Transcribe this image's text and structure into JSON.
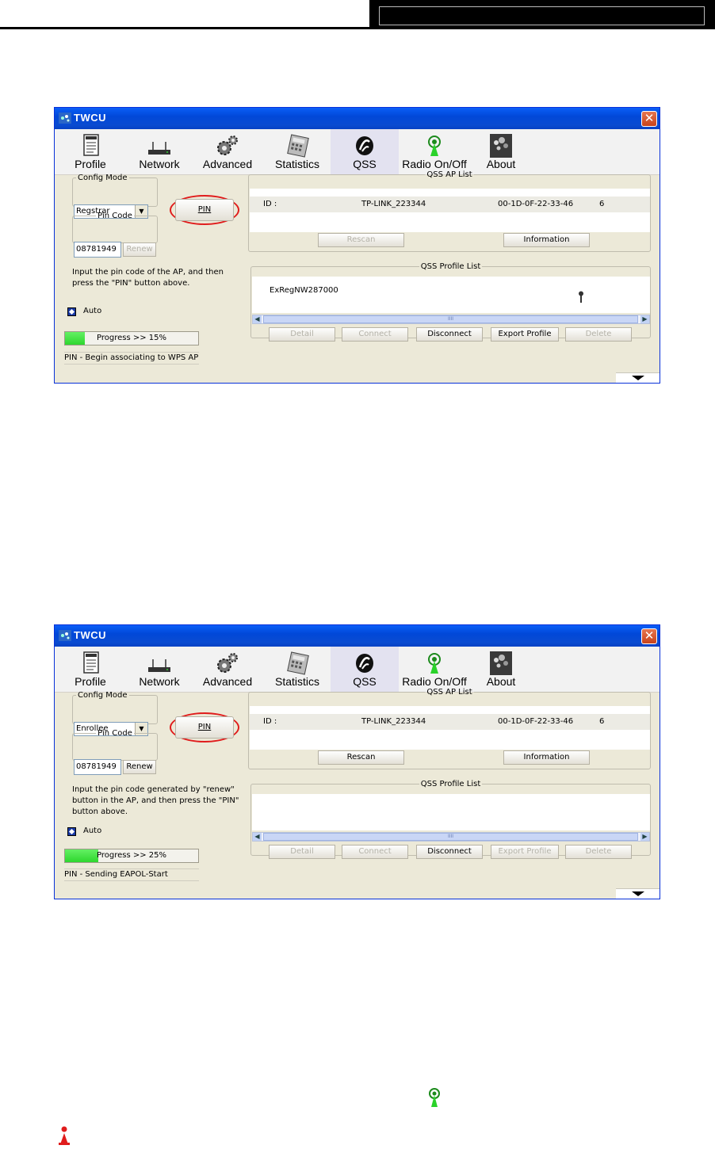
{
  "windows": [
    {
      "title": "TWCU",
      "toolbar": [
        "Profile",
        "Network",
        "Advanced",
        "Statistics",
        "QSS",
        "Radio On/Off",
        "About"
      ],
      "config_mode_legend": "Config Mode",
      "config_mode_value": "Regstrar",
      "pin_button": "PIN",
      "pin_code_legend": "Pin Code",
      "pin_code_value": "08781949",
      "renew_button": "Renew",
      "renew_enabled": false,
      "instruction": "Input the pin code of the AP, and then press the \"PIN\" button above.",
      "auto_label": "Auto",
      "progress_text": "Progress >> 15%",
      "progress_fraction": 0.15,
      "status": "PIN - Begin associating to WPS AP",
      "ap_list_legend": "QSS AP List",
      "ap_row": {
        "id_label": "ID :",
        "ssid": "TP-LINK_223344",
        "mac": "00-1D-0F-22-33-46",
        "channel": "6"
      },
      "rescan_button": "Rescan",
      "rescan_enabled": false,
      "information_button": "Information",
      "profile_list_legend": "QSS Profile List",
      "profile_entry": "ExRegNW287000",
      "profile_buttons": [
        {
          "label": "Detail",
          "enabled": false
        },
        {
          "label": "Connect",
          "enabled": false
        },
        {
          "label": "Disconnect",
          "enabled": true
        },
        {
          "label": "Export Profile",
          "enabled": true
        },
        {
          "label": "Delete",
          "enabled": false
        }
      ],
      "scroll_thumb": "IIII"
    },
    {
      "title": "TWCU",
      "toolbar": [
        "Profile",
        "Network",
        "Advanced",
        "Statistics",
        "QSS",
        "Radio On/Off",
        "About"
      ],
      "config_mode_legend": "Config Mode",
      "config_mode_value": "Enrollee",
      "pin_button": "PIN",
      "pin_code_legend": "Pin Code",
      "pin_code_value": "08781949",
      "renew_button": "Renew",
      "renew_enabled": true,
      "instruction": "Input the pin code generated by \"renew\" button in the AP, and then press the \"PIN\" button above.",
      "auto_label": "Auto",
      "progress_text": "Progress >> 25%",
      "progress_fraction": 0.25,
      "status": "PIN - Sending EAPOL-Start",
      "ap_list_legend": "QSS AP List",
      "ap_row": {
        "id_label": "ID :",
        "ssid": "TP-LINK_223344",
        "mac": "00-1D-0F-22-33-46",
        "channel": "6"
      },
      "rescan_button": "Rescan",
      "rescan_enabled": true,
      "information_button": "Information",
      "profile_list_legend": "QSS Profile List",
      "profile_entry": "",
      "profile_buttons": [
        {
          "label": "Detail",
          "enabled": false
        },
        {
          "label": "Connect",
          "enabled": false
        },
        {
          "label": "Disconnect",
          "enabled": true
        },
        {
          "label": "Export Profile",
          "enabled": false
        },
        {
          "label": "Delete",
          "enabled": false
        }
      ],
      "scroll_thumb": "IIII"
    }
  ],
  "colors": {
    "titlebar": "#0148d8",
    "highlight_ellipse": "#e01c1c",
    "progress_fill": "#2ed72e",
    "note_icon": "#e01c1c"
  },
  "icons": [
    "radio-on-off-icon",
    "note-icon"
  ]
}
